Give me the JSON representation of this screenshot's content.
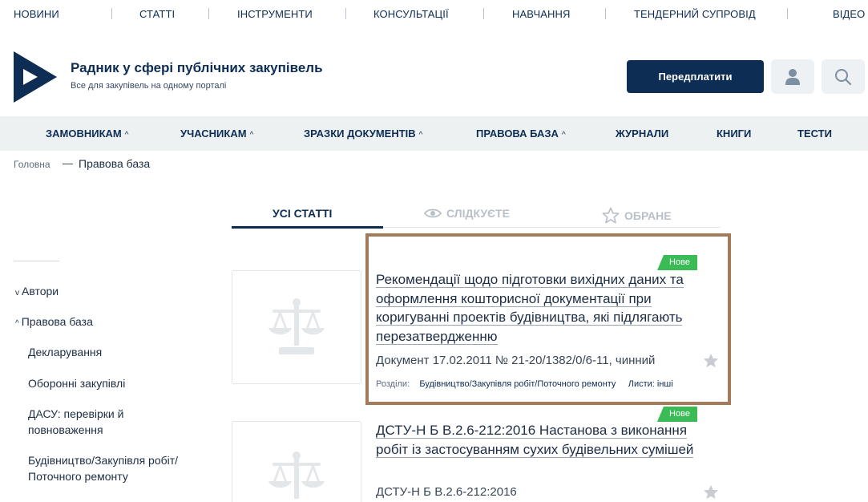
{
  "topnav": [
    "НОВИНИ",
    "СТАТТІ",
    "ІНСТРУМЕНТИ",
    "КОНСУЛЬТАЦІЇ",
    "НАВЧАННЯ",
    "ТЕНДЕРНИЙ СУПРОВІД",
    "ВІДЕО"
  ],
  "header": {
    "title": "Радник у сфері публічних закупівель",
    "subtitle": "Все для закупівель на одному порталі",
    "subscribe_label": "Передплатити"
  },
  "mainmenu": [
    "ЗАМОВНИКАМ",
    "УЧАСНИКАМ",
    "ЗРАЗКИ ДОКУМЕНТІВ",
    "ПРАВОВА БАЗА",
    "ЖУРНАЛИ",
    "КНИГИ",
    "ТЕСТИ"
  ],
  "breadcrumb": {
    "home": "Головна",
    "separator": "—",
    "current": "Правова база"
  },
  "tabs": [
    "УСІ СТАТТІ",
    "СЛІДКУЄТЕ",
    "ОБРАНЕ"
  ],
  "sidebar": {
    "authors": "Автори",
    "legal": "Правова база",
    "items": [
      "Декларування",
      "Оборонні закупівлі",
      "ДАСУ: перевірки й повноваження",
      "Будівництво/Закупівля робіт/ Поточного ремонту"
    ]
  },
  "cards": [
    {
      "badge": "Нове",
      "title": "Рекомендації щодо підготовки вихідних даних та оформлення кошторисної документації при коригуванні проектів будівництва, які підлягають перезатвердженню",
      "doc": "Документ 17.02.2011 № 21-20/1382/0/6-11, чинний",
      "sections_label": "Розділи:",
      "section": "Будівництво/Закупівля робіт/Поточного ремонту",
      "letters": "Листи: інші"
    },
    {
      "badge": "Нове",
      "title": "ДСТУ-Н Б В.2.6-212:2016 Настанова з виконання робіт із застосуванням сухих будівельних сумішей",
      "doc": "ДСТУ-Н Б В.2.6-212:2016"
    }
  ],
  "colors": {
    "brand": "#0d2d55",
    "badge": "#3bbb56",
    "highlight": "#a47b5a"
  },
  "icons": [
    "logo-icon",
    "user-icon",
    "search-icon",
    "eye-icon",
    "star-outline-icon",
    "scales-icon",
    "star-icon"
  ]
}
